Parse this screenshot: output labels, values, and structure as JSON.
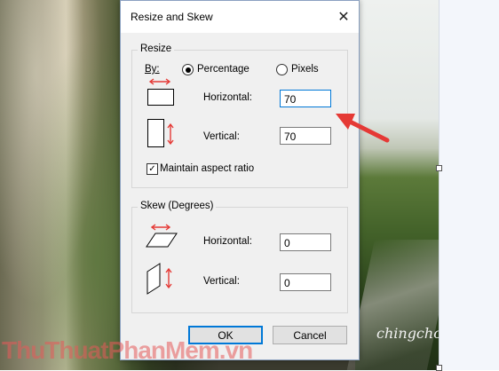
{
  "dialog": {
    "title": "Resize and Skew",
    "close_icon": "close-icon"
  },
  "resize": {
    "group_label": "Resize",
    "by_label": "By:",
    "options": [
      "Percentage",
      "Pixels"
    ],
    "selected": "Percentage",
    "horizontal_label": "Horizontal:",
    "horizontal_value": "70",
    "vertical_label": "Vertical:",
    "vertical_value": "70",
    "maintain_label": "Maintain aspect ratio",
    "maintain_checked": true
  },
  "skew": {
    "group_label": "Skew (Degrees)",
    "horizontal_label": "Horizontal:",
    "horizontal_value": "0",
    "vertical_label": "Vertical:",
    "vertical_value": "0"
  },
  "buttons": {
    "ok": "OK",
    "cancel": "Cancel"
  },
  "watermark": "ThuThuatPhanMem.vn",
  "photo_signature": "chingcho",
  "colors": {
    "accent_red": "#e53935",
    "focus_blue": "#0078d7"
  }
}
